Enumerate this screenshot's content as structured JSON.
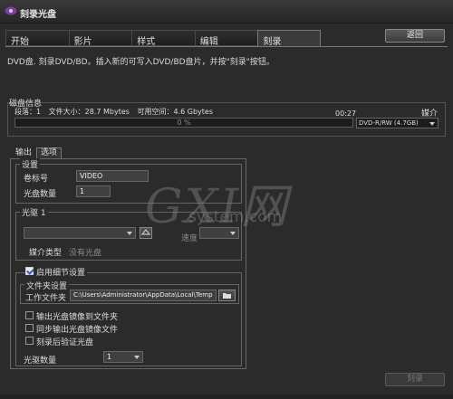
{
  "window": {
    "title": "刻录光盘"
  },
  "tabs": [
    {
      "label": "开始"
    },
    {
      "label": "影片"
    },
    {
      "label": "样式"
    },
    {
      "label": "编辑"
    },
    {
      "label": "刻录"
    }
  ],
  "back_button": "返回",
  "instruction": "DVD盘. 刻录DVD/BD。插入新的可写入DVD/BD盘片，并按\"刻录\"按钮。",
  "disk_info": {
    "section_label": "磁盘信息",
    "segment": "段落：1",
    "file_size": "文件大小：28.7 Mbytes",
    "free_space": "可用空间：4.6 Gbytes",
    "media_label": "媒介",
    "time": "00:27",
    "progress_text": "0 %",
    "progress_value": 0,
    "media_value": "DVD-R/RW (4.7GB)"
  },
  "subtabs": [
    {
      "label": "输出"
    },
    {
      "label": "选项"
    }
  ],
  "settings": {
    "group_label": "设置",
    "volume_label": "卷标号",
    "volume_value": "VIDEO",
    "disc_count_label": "光盘数量",
    "disc_count_value": "1"
  },
  "drive": {
    "group_label": "光驱 1",
    "speed_label": "速度",
    "media_type_label": "媒介类型",
    "media_type_value": "没有光盘"
  },
  "detail": {
    "checkbox_label": "启用细节设置",
    "folder_group_label": "文件夹设置",
    "workfolder_label": "工作文件夹",
    "workfolder_value": "C:\\Users\\Administrator\\AppData\\Local\\Temp",
    "opt_image_to_folder": "输出光盘镜像到文件夹",
    "opt_sync_image": "同步输出光盘镜像文件",
    "opt_verify": "刻录后验证光盘",
    "drive_count_label": "光驱数量",
    "drive_count_value": "1"
  },
  "burn_button": "刻录",
  "watermark": {
    "big": "GXI网",
    "small": "system.com"
  }
}
